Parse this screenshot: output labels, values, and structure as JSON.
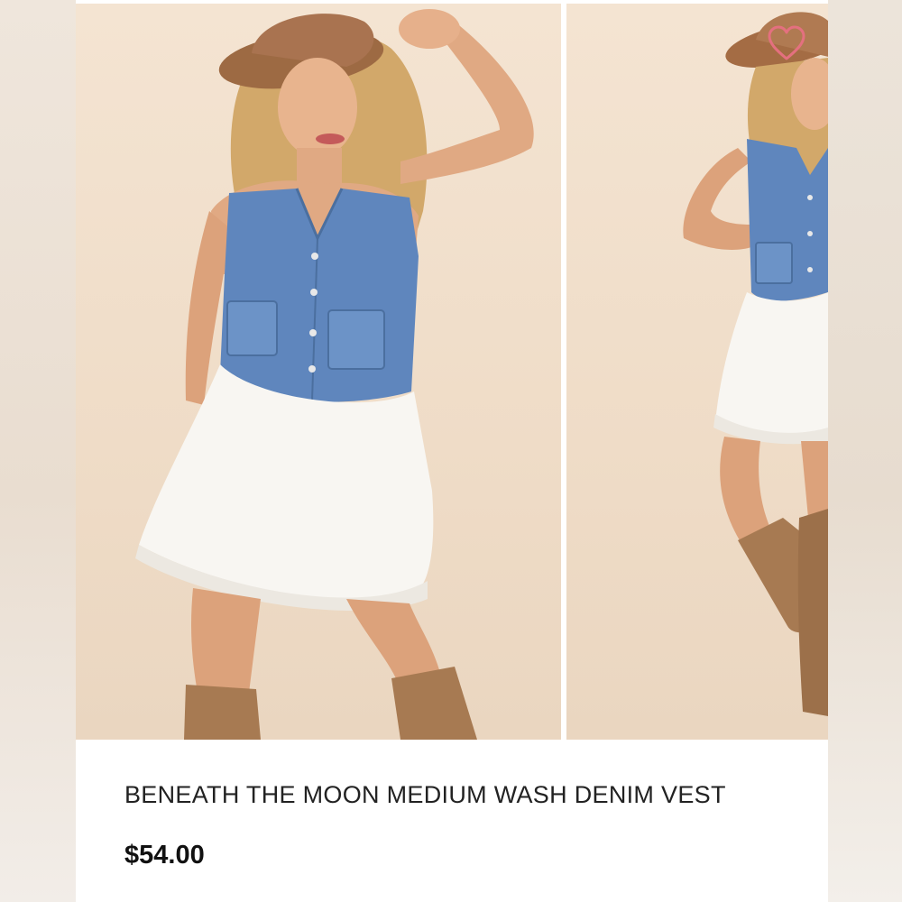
{
  "product": {
    "title": "BENEATH THE MOON MEDIUM WASH DENIM VEST",
    "price": "$54.00"
  },
  "gallery": {
    "images": [
      {
        "name": "model-front-denim-vest"
      },
      {
        "name": "model-side-denim-vest"
      }
    ]
  },
  "wishlist": {
    "icon": "heart-outline-icon",
    "color": "#e4707f"
  },
  "colors": {
    "background": "#ead6c0",
    "denim": "#5f86bd",
    "skirt": "#f8f6f2",
    "boots": "#a77a52",
    "hat": "#a46c44"
  }
}
